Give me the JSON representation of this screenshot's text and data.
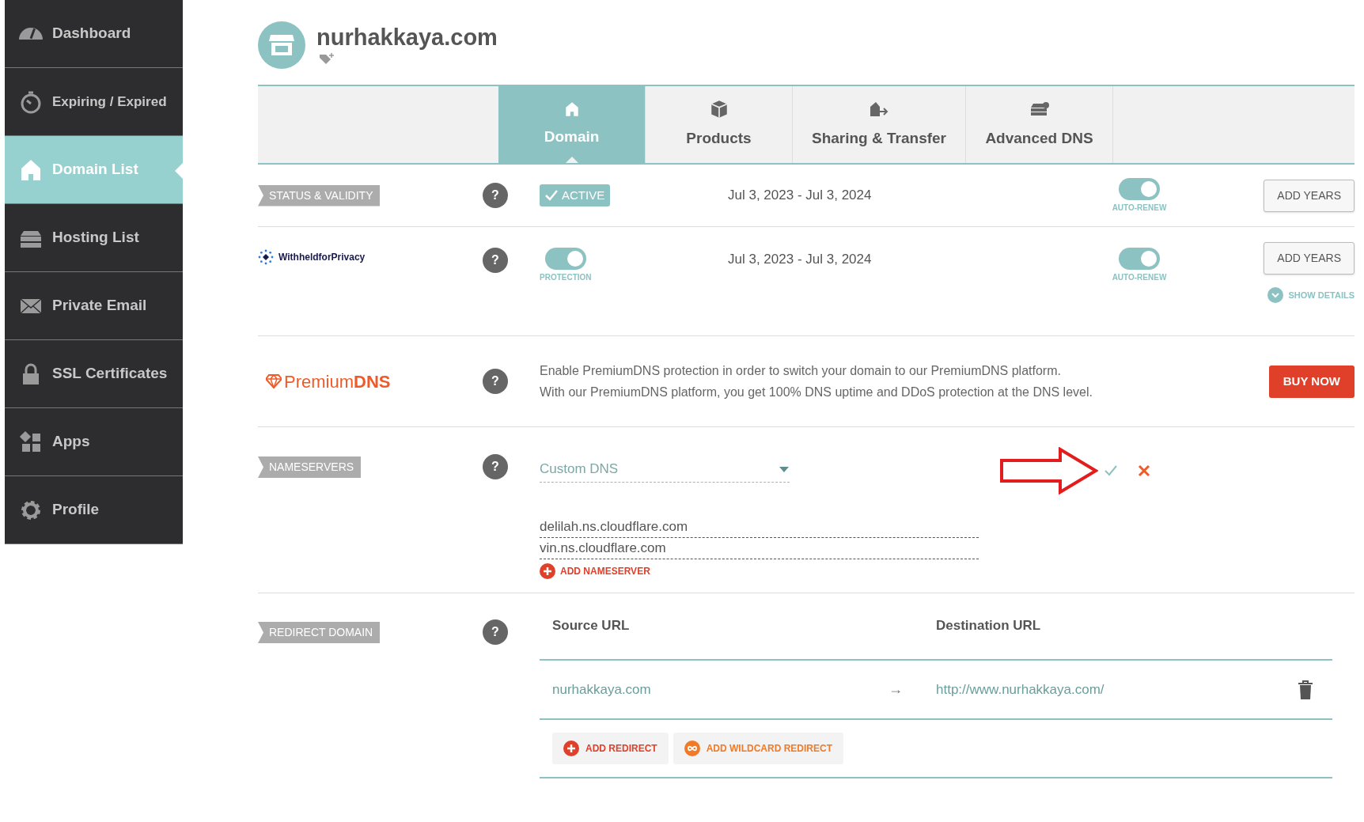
{
  "sidebar": {
    "items": [
      {
        "label": "Dashboard",
        "selected": false
      },
      {
        "label": "Expiring / Expired",
        "selected": false
      },
      {
        "label": "Domain List",
        "selected": true
      },
      {
        "label": "Hosting List",
        "selected": false
      },
      {
        "label": "Private Email",
        "selected": false
      },
      {
        "label": "SSL Certificates",
        "selected": false
      },
      {
        "label": "Apps",
        "selected": false
      },
      {
        "label": "Profile",
        "selected": false
      }
    ]
  },
  "domain": {
    "name": "nurhakkaya.com"
  },
  "tabs": [
    {
      "label": "Domain",
      "selected": true
    },
    {
      "label": "Products",
      "selected": false
    },
    {
      "label": "Sharing & Transfer",
      "selected": false
    },
    {
      "label": "Advanced DNS",
      "selected": false
    }
  ],
  "status": {
    "label": "STATUS & VALIDITY",
    "help": "?",
    "badge": "ACTIVE",
    "dates": "Jul 3, 2023 - Jul 3, 2024",
    "auto_renew": {
      "on": true,
      "label": "AUTO-RENEW"
    },
    "button": "ADD YEARS"
  },
  "privacy": {
    "logo": "WithheldforPrivacy",
    "help": "?",
    "protection": {
      "on": true,
      "label": "PROTECTION"
    },
    "dates": "Jul 3, 2023 - Jul 3, 2024",
    "auto_renew": {
      "on": true,
      "label": "AUTO-RENEW"
    },
    "button": "ADD YEARS",
    "details_link": "SHOW DETAILS"
  },
  "premium_dns": {
    "logo_light": "Premium",
    "logo_bold": "DNS",
    "help": "?",
    "lines": [
      "Enable PremiumDNS protection in order to switch your domain to our PremiumDNS platform.",
      "With our PremiumDNS platform, you get 100% DNS uptime and DDoS protection at the DNS level."
    ],
    "button": "BUY NOW"
  },
  "nameservers": {
    "label": "NAMESERVERS",
    "help": "?",
    "dropdown": "Custom DNS",
    "servers": [
      "delilah.ns.cloudflare.com",
      "vin.ns.cloudflare.com"
    ],
    "add": "ADD NAMESERVER"
  },
  "redirect": {
    "label": "REDIRECT DOMAIN",
    "help": "?",
    "columns": [
      "Source URL",
      "Destination URL"
    ],
    "rows": [
      {
        "source": "nurhakkaya.com",
        "arrow": "→",
        "destination": "http://www.nurhakkaya.com/"
      }
    ],
    "buttons": [
      {
        "kind": "add",
        "label": "ADD REDIRECT"
      },
      {
        "kind": "wildcard",
        "label": "ADD WILDCARD REDIRECT"
      }
    ]
  }
}
